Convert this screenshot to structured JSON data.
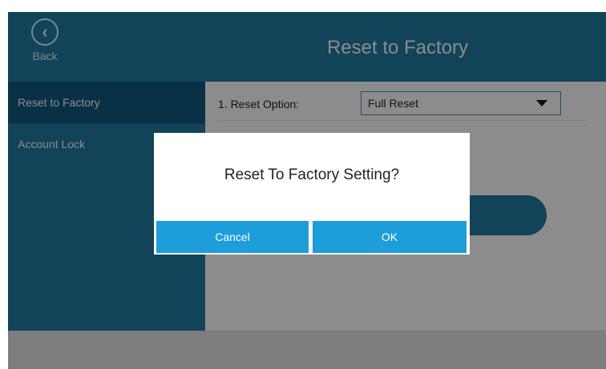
{
  "header": {
    "back_label": "Back",
    "back_icon": "chevron-left-icon",
    "title": "Reset to Factory"
  },
  "sidebar": {
    "items": [
      {
        "label": "Reset to Factory",
        "active": true
      },
      {
        "label": "Account Lock",
        "active": false
      }
    ]
  },
  "main": {
    "reset_option": {
      "label": "1. Reset Option:",
      "value": "Full Reset"
    }
  },
  "dialog": {
    "message": "Reset To Factory Setting?",
    "cancel_label": "Cancel",
    "ok_label": "OK"
  },
  "colors": {
    "primary": "#1f7aa3",
    "active_item": "#0f5a7e",
    "dialog_button": "#1e9ddb",
    "footer": "#e5e5e5"
  }
}
